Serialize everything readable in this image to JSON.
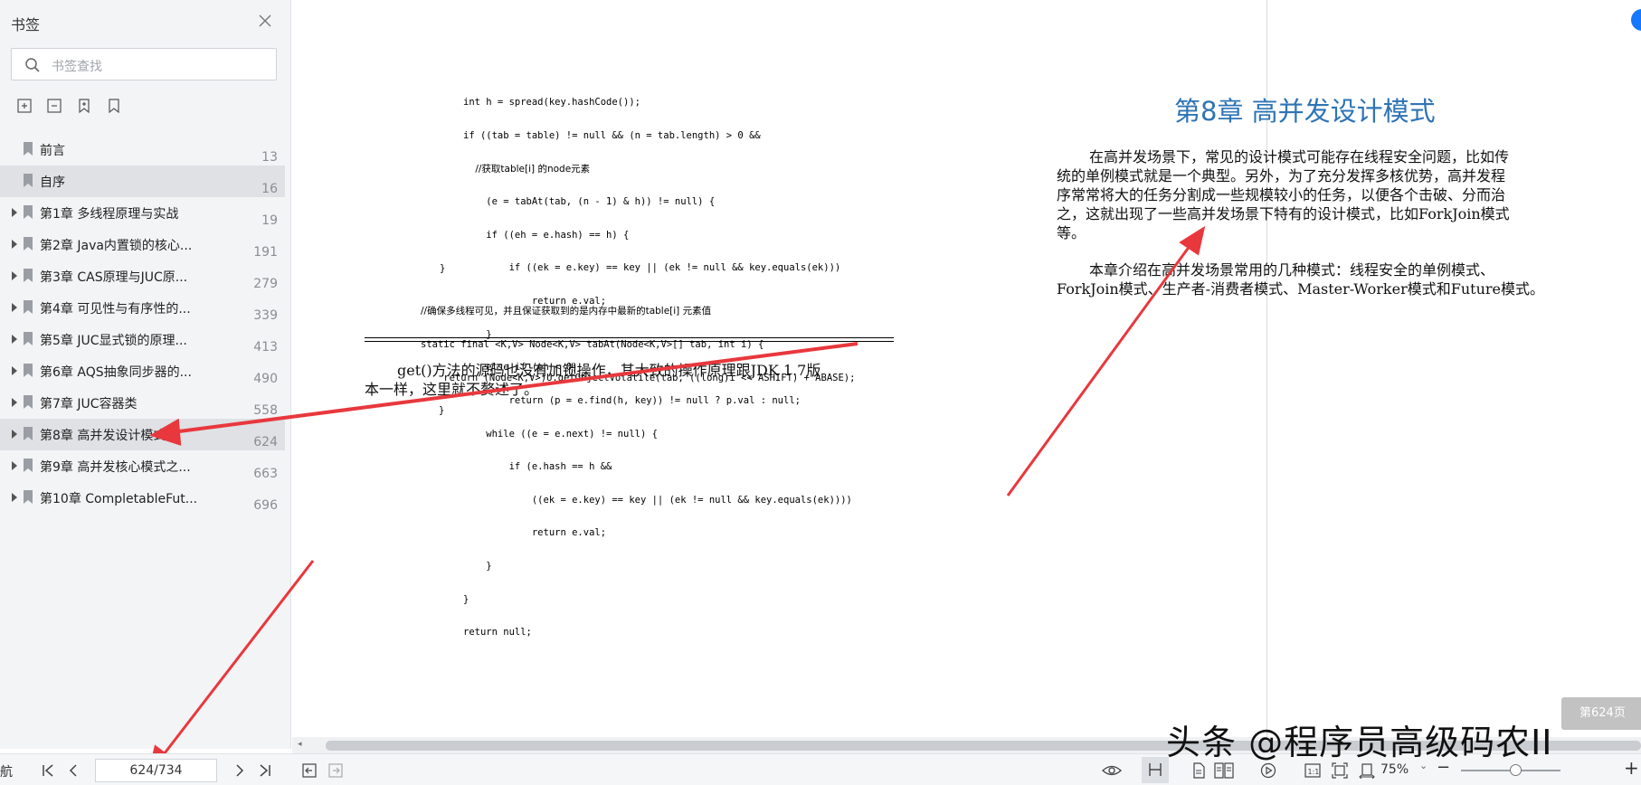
{
  "sidebar": {
    "title": "书签",
    "search_placeholder": "书签查找",
    "items": [
      {
        "label": "前言",
        "page": "13",
        "expandable": false,
        "selected": false
      },
      {
        "label": "自序",
        "page": "16",
        "expandable": false,
        "selected": true
      },
      {
        "label": "第1章 多线程原理与实战",
        "page": "19",
        "expandable": true,
        "selected": false
      },
      {
        "label": "第2章 Java内置锁的核心...",
        "page": "191",
        "expandable": true,
        "selected": false
      },
      {
        "label": "第3章 CAS原理与JUC原...",
        "page": "279",
        "expandable": true,
        "selected": false
      },
      {
        "label": "第4章 可见性与有序性的...",
        "page": "339",
        "expandable": true,
        "selected": false
      },
      {
        "label": "第5章 JUC显式锁的原理...",
        "page": "413",
        "expandable": true,
        "selected": false
      },
      {
        "label": "第6章 AQS抽象同步器的...",
        "page": "490",
        "expandable": true,
        "selected": false
      },
      {
        "label": "第7章 JUC容器类",
        "page": "558",
        "expandable": true,
        "selected": false
      },
      {
        "label": "第8章 高并发设计模式",
        "page": "624",
        "expandable": true,
        "selected": true
      },
      {
        "label": "第9章 高并发核心模式之...",
        "page": "663",
        "expandable": true,
        "selected": false
      },
      {
        "label": "第10章 CompletableFut...",
        "page": "696",
        "expandable": true,
        "selected": false
      }
    ]
  },
  "left_page": {
    "code_lines": [
      "int h = spread(key.hashCode());",
      "if ((tab = table) != null && (n = tab.length) > 0 &&",
      "    //获取table[i] 的node元素",
      "    (e = tabAt(tab, (n - 1) & h)) != null) {",
      "    if ((eh = e.hash) == h) {",
      "        if ((ek = e.key) == key || (ek != null && key.equals(ek)))",
      "            return e.val;",
      "    }",
      "    else if (eh < 0)",
      "        return (p = e.find(h, key)) != null ? p.val : null;",
      "    while ((e = e.next) != null) {",
      "        if (e.hash == h &&",
      "            ((ek = e.key) == key || (ek != null && key.equals(ek))))",
      "            return e.val;",
      "    }",
      "}",
      "return null;"
    ],
    "code_close_brace": "}",
    "code2_lines": [
      "//确保多线程可见，并且保证获取到的是内存中最新的table[i] 元素值",
      "static final <K,V> Node<K,V> tabAt(Node<K,V>[] tab, int i) {",
      "    return (Node<K,V>)U.getObjectVolatile(tab, ((long)i << ASHIFT) + ABASE);",
      "}"
    ],
    "paragraph_line1": "get()方法的源码也没有加锁操作，其大致的操作原理跟JDK 1.7版",
    "paragraph_line2": "本一样，这里就不赘述了。"
  },
  "right_page": {
    "chapter_title": "第8章    高并发设计模式",
    "para1_lines": [
      "在高并发场景下，常见的设计模式可能存在线程安全问题，比如传",
      "统的单例模式就是一个典型。另外，为了充分发挥多核优势，高并发程",
      "序常常将大的任务分割成一些规模较小的任务，以便各个击破、分而治",
      "之，这就出现了一些高并发场景下特有的设计模式，比如ForkJoin模式",
      "等。"
    ],
    "para2_lines": [
      "本章介绍在高并发场景常用的几种模式：线程安全的单例模式、",
      "ForkJoin模式、生产者-消费者模式、Master-Worker模式和Future模式。"
    ]
  },
  "toolbar": {
    "nav_label": "航",
    "page_indicator": "624/734",
    "zoom": "75%"
  },
  "overlay": {
    "watermark": "头条 @程序员高级码农II",
    "page_pill": "第624页"
  },
  "colors": {
    "accent": "#2e74b5",
    "arrow": "#e8383d",
    "sidebar_bg": "#f3f4f6",
    "selected_bg": "#dfe1e5"
  }
}
